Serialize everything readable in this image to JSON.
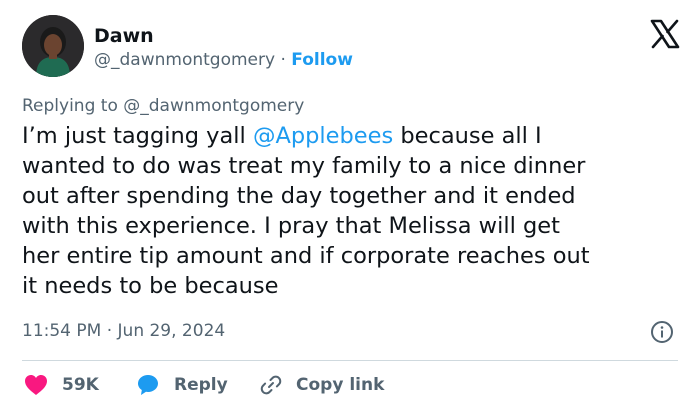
{
  "author": {
    "name": "Dawn",
    "handle": "@_dawnmontgomery",
    "separator": "·",
    "follow_label": "Follow"
  },
  "logo": "x-logo-icon",
  "reply_context": {
    "prefix": "Replying to",
    "handle": "@_dawnmontgomery"
  },
  "tweet": {
    "text_before": "I’m just tagging yall ",
    "mention": "@Applebees",
    "text_after": " because all I\nwanted to do was treat my family to a nice dinner\nout after spending the day together and it ended\nwith this experience. I pray that Melissa will get\nher entire tip amount and if corporate reaches out\nit needs to be because"
  },
  "timestamp": "11:54 PM · Jun 29, 2024",
  "actions": {
    "like_count": "59K",
    "reply_label": "Reply",
    "copy_label": "Copy link"
  },
  "colors": {
    "link": "#1d9bf0",
    "like": "#f91880",
    "muted": "#536471"
  }
}
